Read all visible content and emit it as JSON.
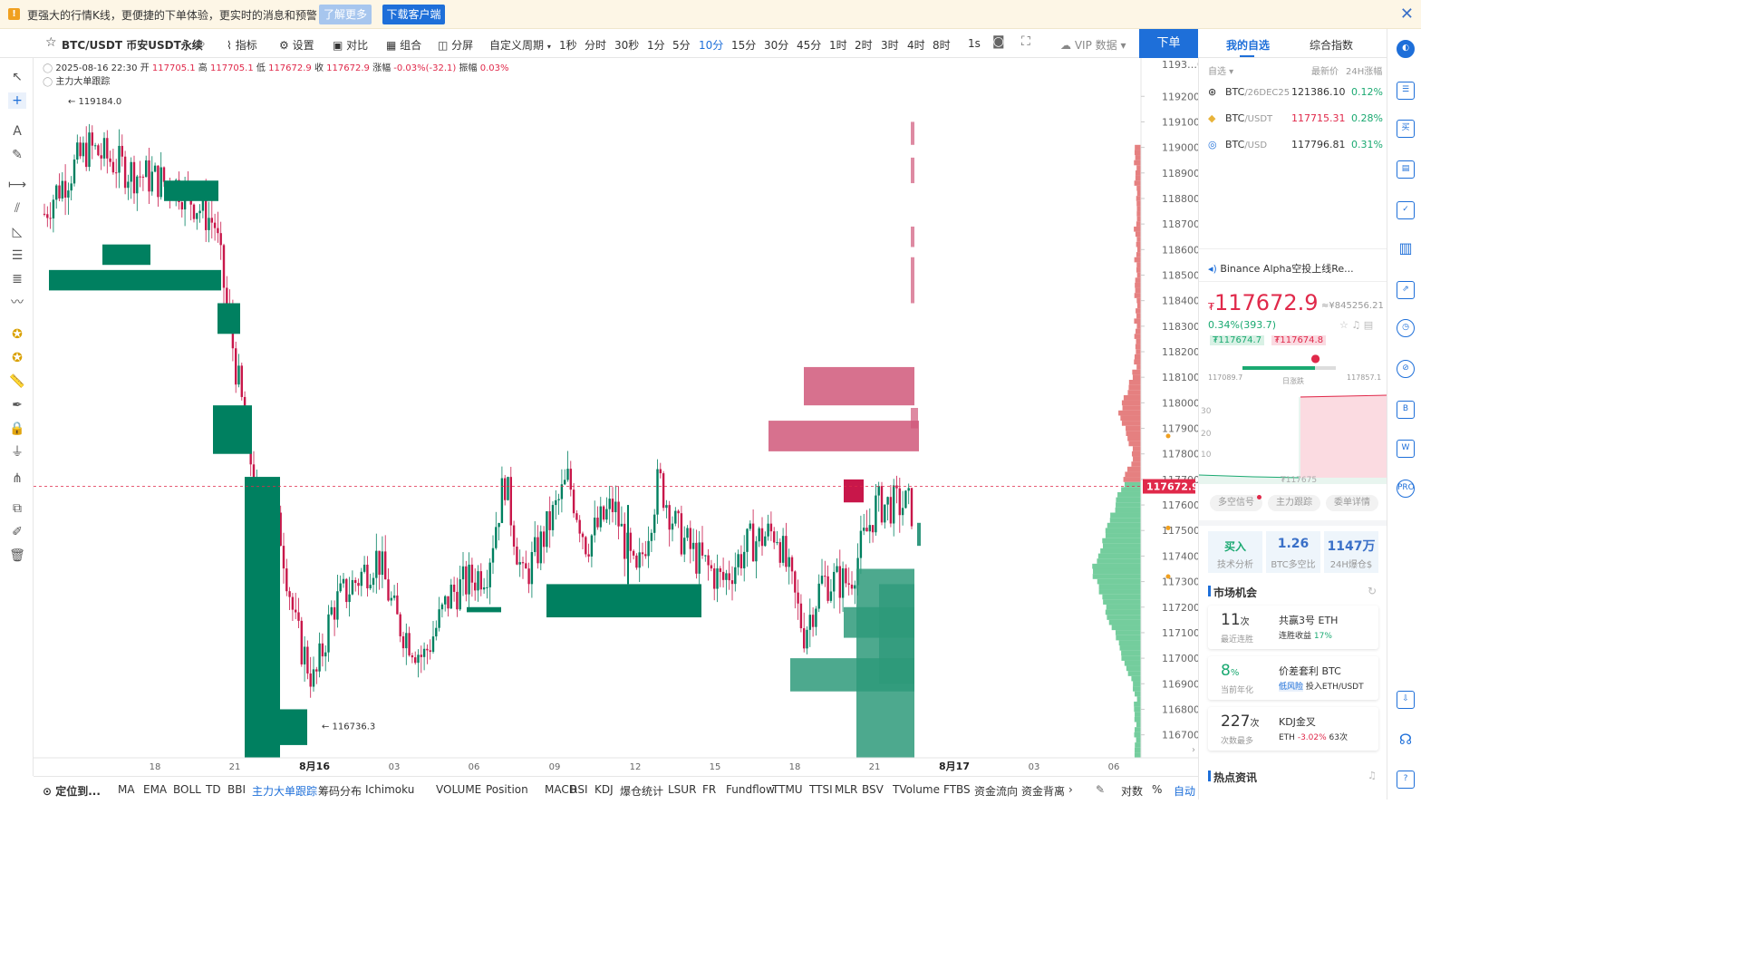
{
  "banner": {
    "message": "更强大的行情K线，更便捷的下单体验，更实时的消息和预警",
    "learn_more": "了解更多",
    "download": "下载客户端"
  },
  "header": {
    "symbol": "BTC/USDT 币安USDT永续",
    "indicator": "指标",
    "settings": "设置",
    "compare": "对比",
    "combine": "组合",
    "split": "分屏",
    "custom_period": "自定义周期",
    "periods": [
      "1秒",
      "分时",
      "30秒",
      "1分",
      "5分",
      "10分",
      "15分",
      "30分",
      "45分",
      "1时",
      "2时",
      "3时",
      "4时",
      "8时"
    ],
    "active_period": "10分",
    "interval_label": "1s",
    "vip": "VIP 数据",
    "order": "下单",
    "tabs": [
      "我的自选",
      "综合指数"
    ]
  },
  "ohlc": {
    "date": "2025-08-16 22:30",
    "open_label": "开",
    "open": "117705.1",
    "high_label": "高",
    "high": "117705.1",
    "low_label": "低",
    "low": "117672.9",
    "close_label": "收",
    "close": "117672.9",
    "change_label": "涨幅",
    "change": "-0.03%(-32.1)",
    "amp_label": "振幅",
    "amp": "0.03%",
    "overlay": "主力大单跟踪"
  },
  "chart_data": {
    "type": "candlestick",
    "ylim": [
      116610,
      119350
    ],
    "y_ticks": [
      "119200.0",
      "119100.0",
      "119000.0",
      "118900.0",
      "118800.0",
      "118700.0",
      "118600.0",
      "118500.0",
      "118400.0",
      "118300.0",
      "118200.0",
      "118100.0",
      "118000.0",
      "117900.0",
      "117800.0",
      "117700.0",
      "117600.0",
      "117500.0",
      "117400.0",
      "117300.0",
      "117200.0",
      "117100.0",
      "117000.0",
      "116900.0",
      "116800.0",
      "116700.0"
    ],
    "top_tick_partial": "1193…0",
    "x_ticks": [
      "18",
      "21",
      "8月16",
      "03",
      "06",
      "09",
      "12",
      "15",
      "18",
      "21",
      "8月17",
      "03",
      "06"
    ],
    "max_label": "119184.0",
    "min_label": "116736.3",
    "current_price": "117672.9",
    "max_price": 119184.0,
    "min_price": 116736.3,
    "last_price": 117672.9,
    "colors": {
      "up": "#008060",
      "down": "#c8174a",
      "sell_wall": "#d0587a",
      "buy_wall": "#2e9a7a"
    }
  },
  "watchlist": {
    "header": "自选",
    "price_col": "最新价",
    "change_col": "24H涨幅",
    "rows": [
      {
        "base": "BTC",
        "quote": "/26DEC25",
        "price": "121386.10",
        "change": "0.12%",
        "price_color": "#333333"
      },
      {
        "base": "BTC",
        "quote": "/USDT",
        "price": "117715.31",
        "change": "0.28%",
        "price_color": "#e0294a"
      },
      {
        "base": "BTC",
        "quote": "/USD",
        "price": "117796.81",
        "change": "0.31%",
        "price_color": "#333333"
      }
    ]
  },
  "news": "Binance Alpha空投上线Re...",
  "quote": {
    "price": "117672.9",
    "cny": "≈¥845256.21",
    "change": "0.34%(393.7)",
    "bid": "₮117674.7",
    "ask": "₮117674.8",
    "range_low": "117089.7",
    "range_label": "日涨跌",
    "range_high": "117857.1",
    "range_pos": 0.78,
    "depth_ticks": [
      "30",
      "20",
      "10"
    ],
    "depth_price": "₮117675",
    "buttons": [
      "多空信号",
      "主力跟踪",
      "委单详情"
    ]
  },
  "stats": [
    {
      "value": "买入",
      "label": "技术分析"
    },
    {
      "value": "1.26",
      "label": "BTC多空比"
    },
    {
      "value": "1147万",
      "label": "24H爆仓$"
    }
  ],
  "opportunity": {
    "title": "市场机会",
    "cards": [
      {
        "num": "11",
        "unit": "次",
        "sub": "最近连胜",
        "title": "共赢3号 ETH",
        "detail_label": "连胜收益",
        "detail_value": "17%"
      },
      {
        "num": "8",
        "unit": "%",
        "sub": "当前年化",
        "title": "价差套利 BTC",
        "detail_label": "低风险",
        "detail_value": "投入ETH/USDT"
      },
      {
        "num": "227",
        "unit": "次",
        "sub": "次数最多",
        "title": "KDJ金叉",
        "detail_label": "ETH",
        "detail_value": "-3.02%",
        "extra": "63次"
      }
    ]
  },
  "hot_news": "热点资讯",
  "bottom": {
    "locate": "定位到...",
    "indicators": [
      "MA",
      "EMA",
      "BOLL",
      "TD",
      "BBI",
      "主力大单跟踪",
      "筹码分布",
      "Ichimoku",
      "VOLUME",
      "Position",
      "MACD",
      "RSI",
      "KDJ",
      "爆仓统计",
      "LSUR",
      "FR",
      "Fundflow",
      "TTMU",
      "TTSI",
      "MLR",
      "BSV",
      "TVolume",
      "FTBS",
      "资金流向",
      "资金背离"
    ],
    "active": "主力大单跟踪",
    "log": "对数",
    "pct": "%",
    "auto": "自动"
  }
}
